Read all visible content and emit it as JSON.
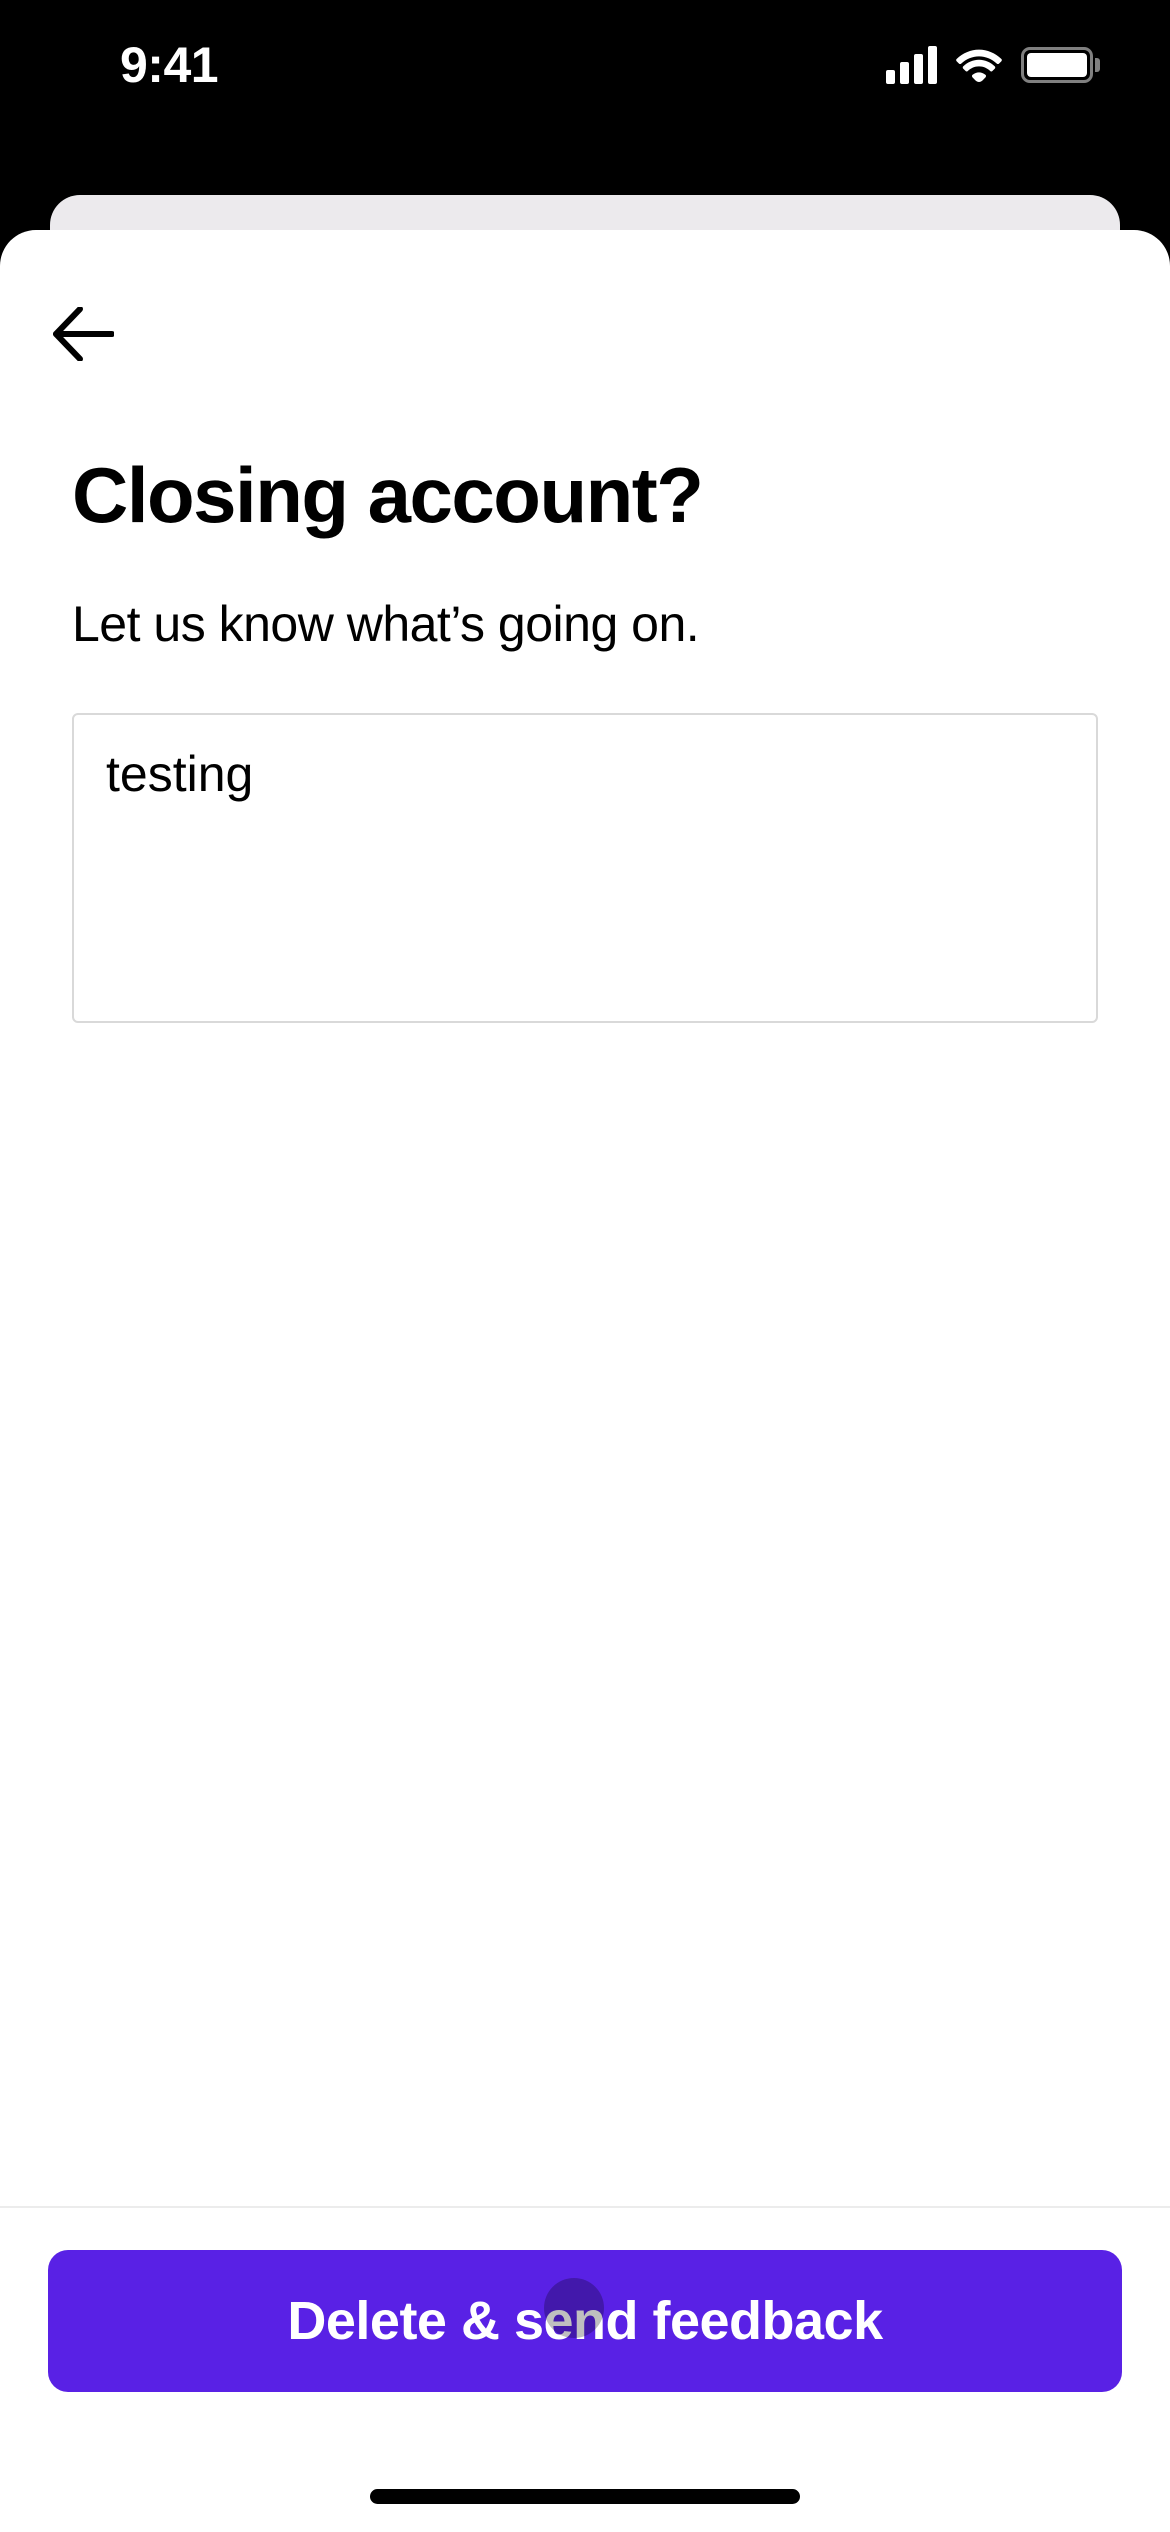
{
  "status_bar": {
    "time": "9:41"
  },
  "page": {
    "title": "Closing account?",
    "subtitle": "Let us know what’s going on.",
    "feedback_value": "testing"
  },
  "footer": {
    "primary_label": "Delete & send feedback"
  }
}
